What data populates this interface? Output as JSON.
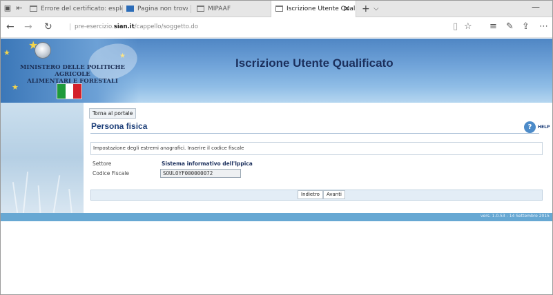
{
  "tabs": [
    {
      "label": "Errore del certificato: esplor"
    },
    {
      "label": "Pagina non trovata"
    },
    {
      "label": "MIPAAF"
    },
    {
      "label": "Iscrizione Utente Qualifi"
    }
  ],
  "address": {
    "prefix": "pre-esercizio.",
    "domain": "sian.it",
    "path": "/cappello/soggetto.do"
  },
  "banner": {
    "ministry_line1": "MINISTERO DELLE POLITICHE AGRICOLE",
    "ministry_line2": "ALIMENTARI E FORESTALI",
    "title": "Iscrizione Utente Qualificato"
  },
  "page": {
    "back_portal": "Torna al portale",
    "title": "Persona fisica",
    "help_label": "HELP",
    "info": "Impostazione degli estremi anagrafici. Inserire il codice fiscale",
    "settore_label": "Settore",
    "settore_value": "Sistema informativo dell'Ippica",
    "cf_label": "Codice Fiscale",
    "cf_value": "SOULOYF000000072",
    "back_button": "Indietro",
    "next_button": "Avanti"
  },
  "footer": {
    "version": "vers. 1.0.53 - 14 Settembre 2015"
  },
  "colors": {
    "flag_green": "#1e9a3b",
    "flag_white": "#ffffff",
    "flag_red": "#d3202a",
    "accent": "#1d3f79"
  }
}
